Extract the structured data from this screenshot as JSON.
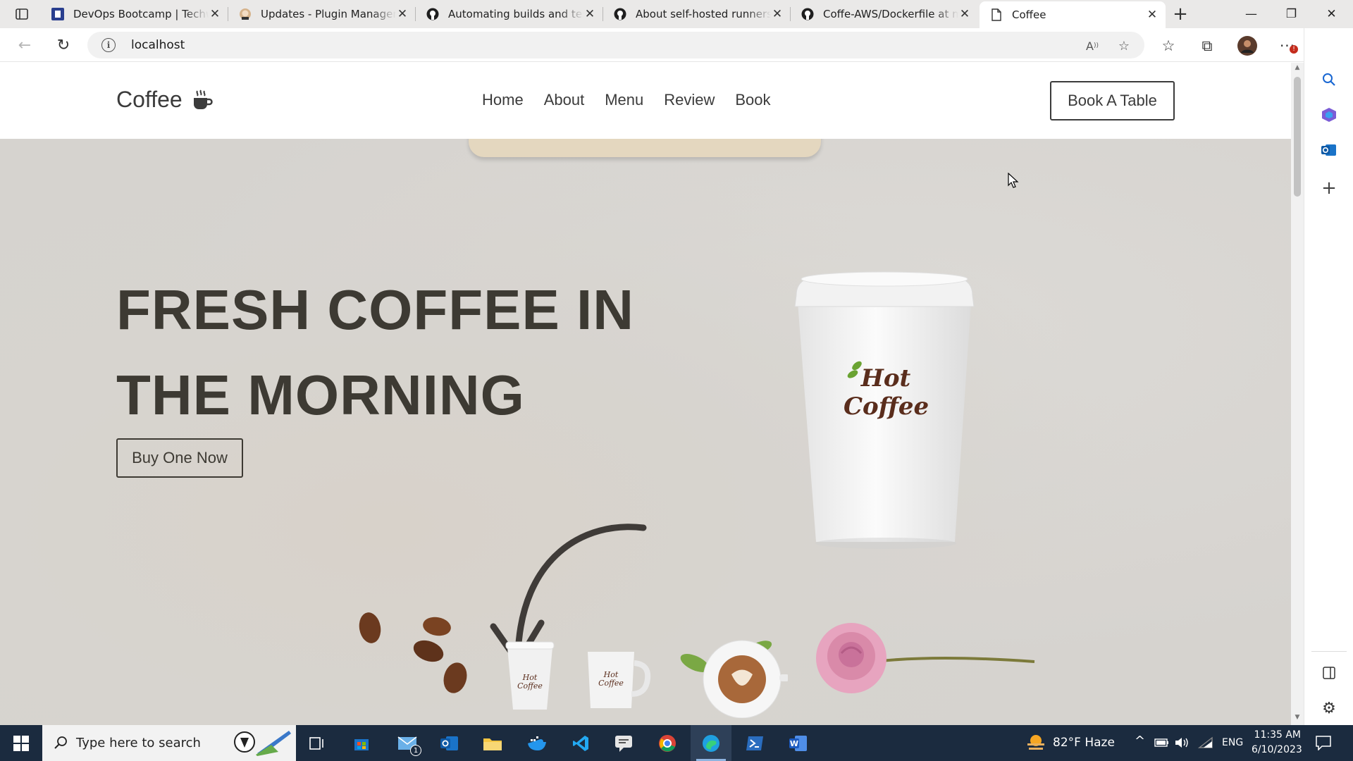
{
  "browser": {
    "tabs": [
      {
        "title": "DevOps Bootcamp | Techworld"
      },
      {
        "title": "Updates - Plugin Manager [Jenkins]"
      },
      {
        "title": "Automating builds and tests"
      },
      {
        "title": "About self-hosted runners - GitHub"
      },
      {
        "title": "Coffe-AWS/Dockerfile at main"
      },
      {
        "title": "Coffee"
      }
    ],
    "address": "localhost"
  },
  "site": {
    "logo": "Coffee",
    "nav": [
      "Home",
      "About",
      "Menu",
      "Review",
      "Book"
    ],
    "book_button": "Book A Table",
    "hero_line1": "FRESH COFFEE IN",
    "hero_line2": "THE MORNING",
    "buy_button": "Buy One Now",
    "cup_logo_line1": "Hot",
    "cup_logo_line2": "Coffee"
  },
  "taskbar": {
    "search_placeholder": "Type here to search",
    "weather": "82°F Haze",
    "language": "ENG",
    "time": "11:35 AM",
    "date": "6/10/2023",
    "mail_badge": "1"
  },
  "colors": {
    "accent_text": "#3d3a33",
    "taskbar_bg": "#1b2b3f"
  }
}
